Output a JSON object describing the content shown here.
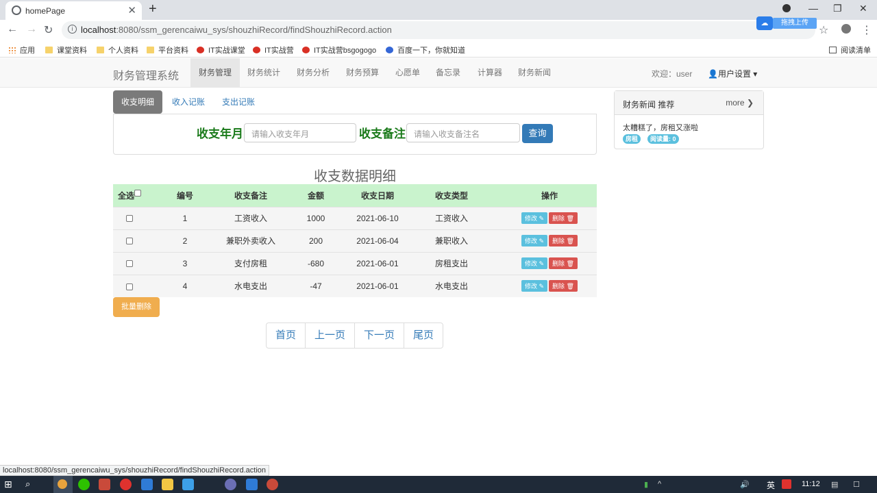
{
  "browser": {
    "tab_title": "homePage",
    "url_host": "localhost",
    "url_rest": ":8080/ssm_gerencaiwu_sys/shouzhiRecord/findShouzhiRecord.action",
    "upload_label": "拖拽上传",
    "bookmarks": [
      "应用",
      "课堂资料",
      "个人资料",
      "平台资料",
      "IT实战课堂",
      "IT实战营",
      "IT实战营bsgogogo",
      "百度一下，你就知道"
    ],
    "reading_list": "阅读清单"
  },
  "navbar": {
    "brand": "财务管理系统",
    "items": [
      "财务管理",
      "财务统计",
      "财务分析",
      "财务预算",
      "心愿单",
      "备忘录",
      "计算器",
      "财务新闻"
    ],
    "welcome": "欢迎：user",
    "user_settings": "用户设置"
  },
  "subtabs": [
    "收支明细",
    "收入记账",
    "支出记账"
  ],
  "search": {
    "month_label": "收支年月",
    "month_placeholder": "请输入收支年月",
    "note_label": "收支备注",
    "note_placeholder": "请输入收支备注名",
    "query_button": "查询"
  },
  "table": {
    "title": "收支数据明细",
    "select_all": "全选",
    "headers": [
      "编号",
      "收支备注",
      "金额",
      "收支日期",
      "收支类型",
      "操作"
    ],
    "edit_label": "修改",
    "delete_label": "删除",
    "rows": [
      {
        "id": "1",
        "note": "工资收入",
        "amount": "1000",
        "date": "2021-06-10",
        "type": "工资收入"
      },
      {
        "id": "2",
        "note": "兼职外卖收入",
        "amount": "200",
        "date": "2021-06-04",
        "type": "兼职收入"
      },
      {
        "id": "3",
        "note": "支付房租",
        "amount": "-680",
        "date": "2021-06-01",
        "type": "房租支出"
      },
      {
        "id": "4",
        "note": "水电支出",
        "amount": "-47",
        "date": "2021-06-01",
        "type": "水电支出"
      }
    ]
  },
  "batch_delete": "批量删除",
  "pager": [
    "首页",
    "上一页",
    "下一页",
    "尾页"
  ],
  "news": {
    "title": "财务新闻 推荐",
    "more": "more",
    "item": "太糟糕了，房租又涨啦",
    "tag": "房租",
    "reads": "阅读量: 0"
  },
  "statusbar": "localhost:8080/ssm_gerencaiwu_sys/shouzhiRecord/findShouzhiRecord.action",
  "taskbar": {
    "ime": "英",
    "clock": "11:12"
  }
}
